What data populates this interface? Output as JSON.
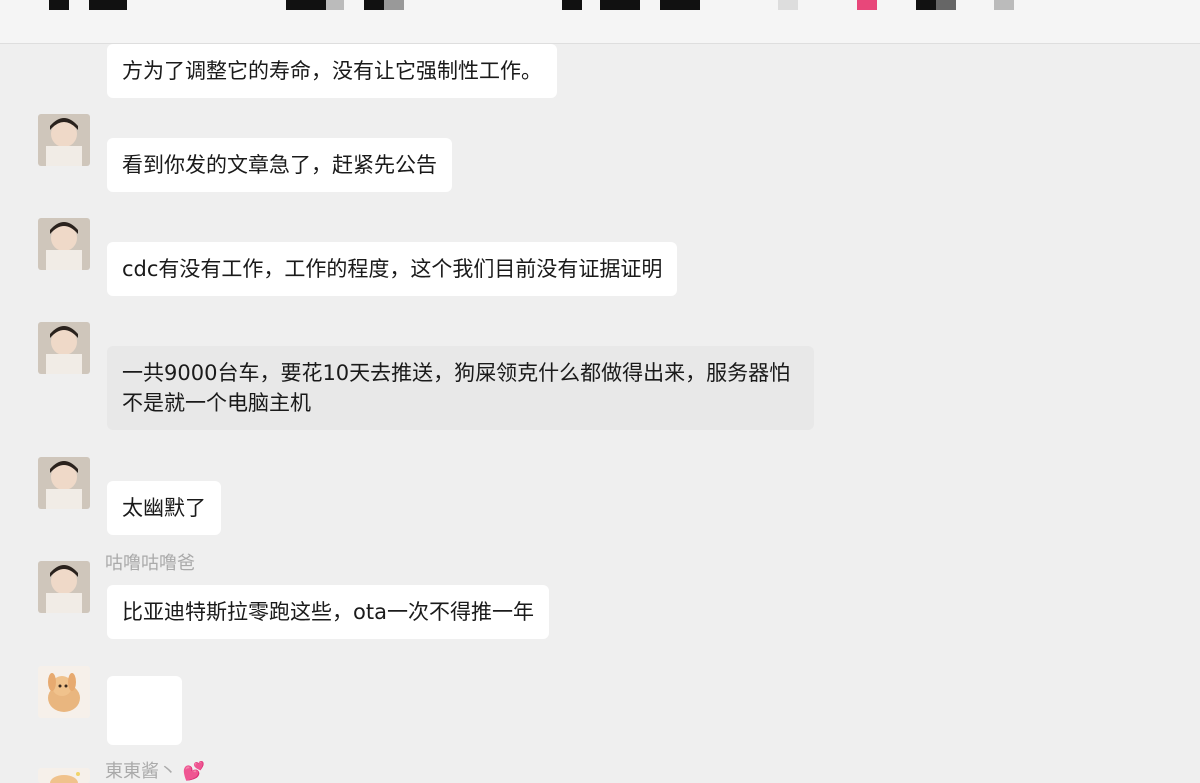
{
  "header": {
    "redaction_color_dark": "#111111",
    "redaction_color_gray": "#bbbbbb",
    "redaction_color_pink": "#e8477a"
  },
  "messages": [
    {
      "sender": "",
      "text": "方为了调整它的寿命，没有让它强制性工作。"
    },
    {
      "sender": "",
      "text": "看到你发的文章急了，赶紧先公告"
    },
    {
      "sender": "",
      "text": "cdc有没有工作，工作的程度，这个我们目前没有证据证明"
    },
    {
      "sender": "",
      "text": "一共9000台车，要花10天去推送，狗屎领克什么都做得出来，服务器怕不是就一个电脑主机",
      "selected": true
    },
    {
      "sender": "",
      "text": "太幽默了"
    },
    {
      "sender": "咕噜咕噜爸",
      "text": "比亚迪特斯拉零跑这些，ota一次不得推一年"
    },
    {
      "sender": "",
      "text": ""
    },
    {
      "sender": "東東酱丶",
      "sender_icon": "heart-icon",
      "text": ""
    }
  ],
  "colors": {
    "background": "#efefef",
    "bubble": "#ffffff",
    "bubble_selected": "#e8e8e8",
    "sender_name": "#aaaaaa"
  }
}
